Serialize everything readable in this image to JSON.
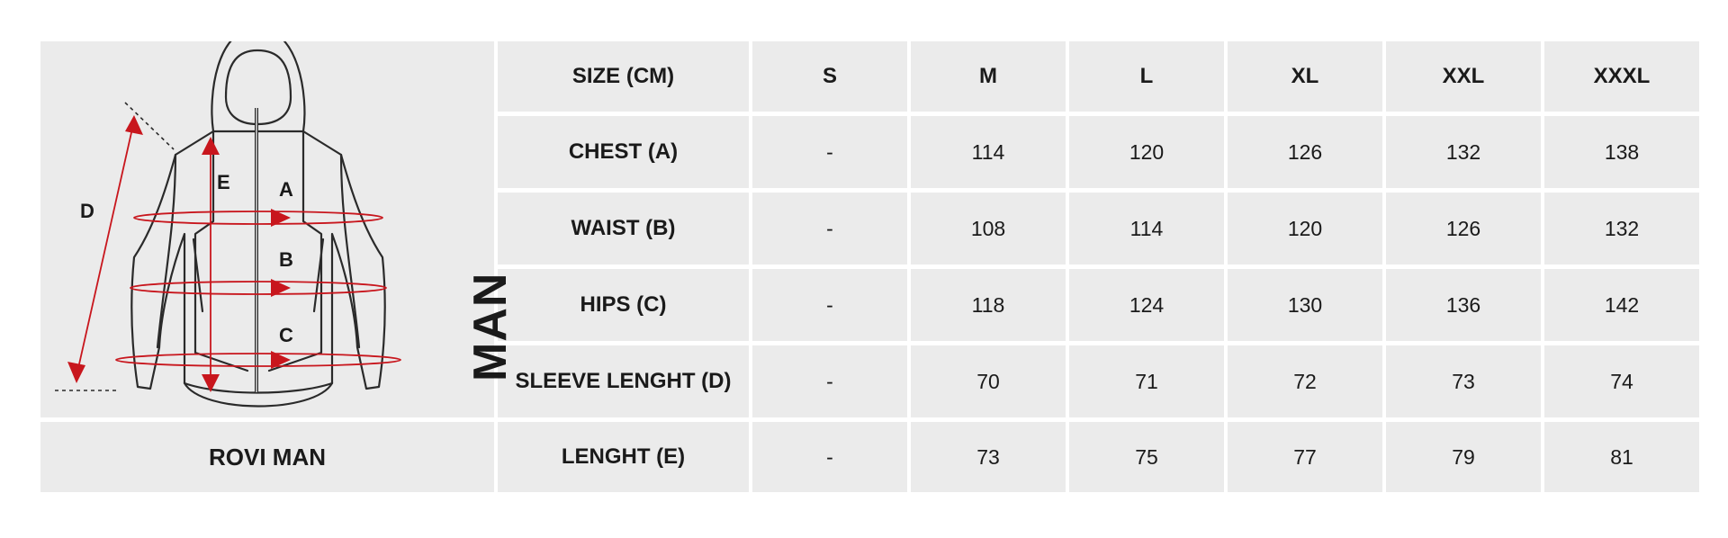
{
  "illustration": {
    "icon": "jacket-measurement-icon",
    "gender_label": "MAN",
    "markers": {
      "chest": "A",
      "waist": "B",
      "hips": "C",
      "sleeve": "D",
      "length": "E"
    },
    "accent_color": "#c8161d"
  },
  "product_name": "ROVI MAN",
  "table": {
    "header": [
      "SIZE (CM)",
      "S",
      "M",
      "L",
      "XL",
      "XXL",
      "XXXL"
    ],
    "rows": [
      {
        "label": "CHEST (A)",
        "values": [
          "-",
          "114",
          "120",
          "126",
          "132",
          "138"
        ]
      },
      {
        "label": "WAIST (B)",
        "values": [
          "-",
          "108",
          "114",
          "120",
          "126",
          "132"
        ]
      },
      {
        "label": "HIPS (C)",
        "values": [
          "-",
          "118",
          "124",
          "130",
          "136",
          "142"
        ]
      },
      {
        "label": "SLEEVE LENGHT (D)",
        "values": [
          "-",
          "70",
          "71",
          "72",
          "73",
          "74"
        ]
      },
      {
        "label": "LENGHT (E)",
        "values": [
          "-",
          "73",
          "75",
          "77",
          "79",
          "81"
        ]
      }
    ]
  }
}
